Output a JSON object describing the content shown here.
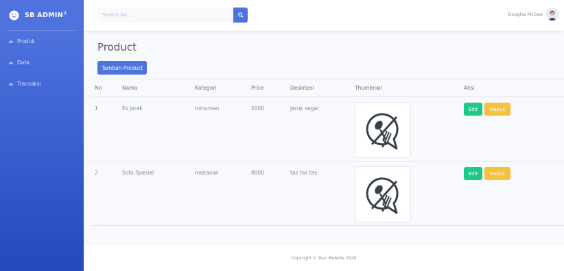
{
  "brand": {
    "name": "SB ADMIN",
    "sup": "2"
  },
  "sidebar": {
    "items": [
      {
        "label": "Produk",
        "icon": "gauge-icon"
      },
      {
        "label": "Data",
        "icon": "gauge-icon"
      },
      {
        "label": "Transaksi",
        "icon": "gauge-icon"
      }
    ]
  },
  "topbar": {
    "search_placeholder": "Search for...",
    "user_name": "Douglas McGee"
  },
  "page": {
    "title": "Product",
    "add_button": "Tambah Product"
  },
  "table": {
    "headers": [
      "No",
      "Nama",
      "Kategori",
      "Price",
      "Deskripsi",
      "Thumbnail",
      "Aksi"
    ],
    "rows": [
      {
        "no": "1",
        "nama": "Es Jerak",
        "kategori": "minuman",
        "price": "2000",
        "deskripsi": "jeruk segar",
        "thumbnail": "no-food-icon"
      },
      {
        "no": "2",
        "nama": "Soto Spesial",
        "kategori": "makanan",
        "price": "8000",
        "deskripsi": "tas tas tas",
        "thumbnail": "no-food-icon"
      }
    ],
    "edit_label": "Edit",
    "delete_label": "Hapus"
  },
  "footer": {
    "text": "Copyright © Your Website 2020"
  },
  "colors": {
    "primary": "#4e73df",
    "success": "#1cc88a",
    "warning": "#f6c23e"
  }
}
